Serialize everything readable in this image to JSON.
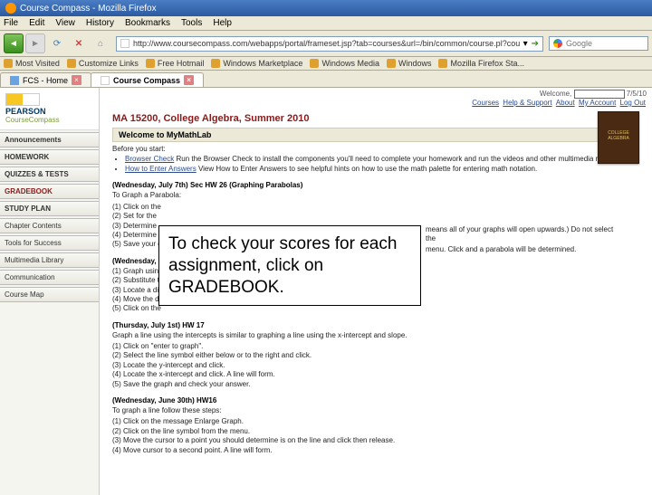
{
  "window": {
    "title": "Course Compass - Mozilla Firefox"
  },
  "menu": [
    "File",
    "Edit",
    "View",
    "History",
    "Bookmarks",
    "Tools",
    "Help"
  ],
  "nav": {
    "url": "http://www.coursecompass.com/webapps/portal/frameset.jsp?tab=courses&url=/bin/common/course.pl?course_id=_52551",
    "search_placeholder": "Google"
  },
  "bookmarks": [
    "Most Visited",
    "Customize Links",
    "Free Hotmail",
    "Windows Marketplace",
    "Windows Media",
    "Windows",
    "Mozilla Firefox Sta..."
  ],
  "tabs": [
    {
      "label": "FCS - Home",
      "active": false
    },
    {
      "label": "Course Compass",
      "active": true
    }
  ],
  "brand": {
    "pearson": "PEARSON",
    "coursecompass": "CourseCompass"
  },
  "left_nav": [
    {
      "label": "Announcements",
      "class": "strong"
    },
    {
      "label": "HOMEWORK",
      "class": "strong"
    },
    {
      "label": "QUIZZES & TESTS",
      "class": "strong"
    },
    {
      "label": "GRADEBOOK",
      "class": "gradebook"
    },
    {
      "label": "STUDY PLAN",
      "class": "strong"
    },
    {
      "label": "Chapter Contents",
      "class": ""
    },
    {
      "label": "Tools for Success",
      "class": ""
    },
    {
      "label": "Multimedia Library",
      "class": ""
    },
    {
      "label": "Communication",
      "class": ""
    },
    {
      "label": "Course Map",
      "class": ""
    }
  ],
  "top_links": {
    "welcome": "Welcome,",
    "date": "7/5/10",
    "links": [
      "Courses",
      "Help & Support",
      "About",
      "My Account",
      "Log Out"
    ]
  },
  "course": {
    "title": "MA 15200, College Algebra, Summer 2010",
    "section": "Welcome to MyMathLab",
    "before": "Before you start:",
    "bullets": [
      "Run the Browser Check to install the components you'll need to complete your homework and run the videos and other multimedia resources.",
      "View How to Enter Answers to see helpful hints on how to use the math palette for entering math notation."
    ],
    "book_label": "COLLEGE ALGEBRA"
  },
  "assignments": [
    {
      "date": "(Wednesday, July 7th) Sec HW 26 (Graphing Parabolas)",
      "intro": "To Graph a Parabola:",
      "steps": "(1) Click on the\n(2) Set for the\n(3) Determine\n(4) Determine\n(5) Save your graph and check your answer.",
      "side_note": "means all of your graphs will open upwards.) Do not select the",
      "side_note2": "menu. Click and a parabola will be determined."
    },
    {
      "date": "(Wednesday, July 14th) HW 19",
      "steps": "(1) Graph using\n(2) Substitute the\n(3) Locate a dir\n(4) Move the dir\n(5) Click on the"
    },
    {
      "date": "(Thursday, July 1st) HW 17",
      "intro": "Graph a line using the intercepts is similar to graphing a line using the x-intercept and slope.",
      "steps": "(1) Click on \"enter to graph\".\n(2) Select the line symbol either below or to the right and click.\n(3) Locate the y-intercept and click.\n(4) Locate the x-intercept and click. A line will form.\n(5) Save the graph and check your answer."
    },
    {
      "date": "(Wednesday, June 30th) HW16",
      "intro": "To graph a line follow these steps:",
      "steps": "(1) Click on the message Enlarge Graph.\n(2) Click on the line symbol from the menu.\n(3) Move the cursor to a point you should determine is on the line and click then release.\n(4) Move cursor to a second point. A line will form."
    }
  ],
  "callout": "To check your scores for each assignment, click on GRADEBOOK."
}
